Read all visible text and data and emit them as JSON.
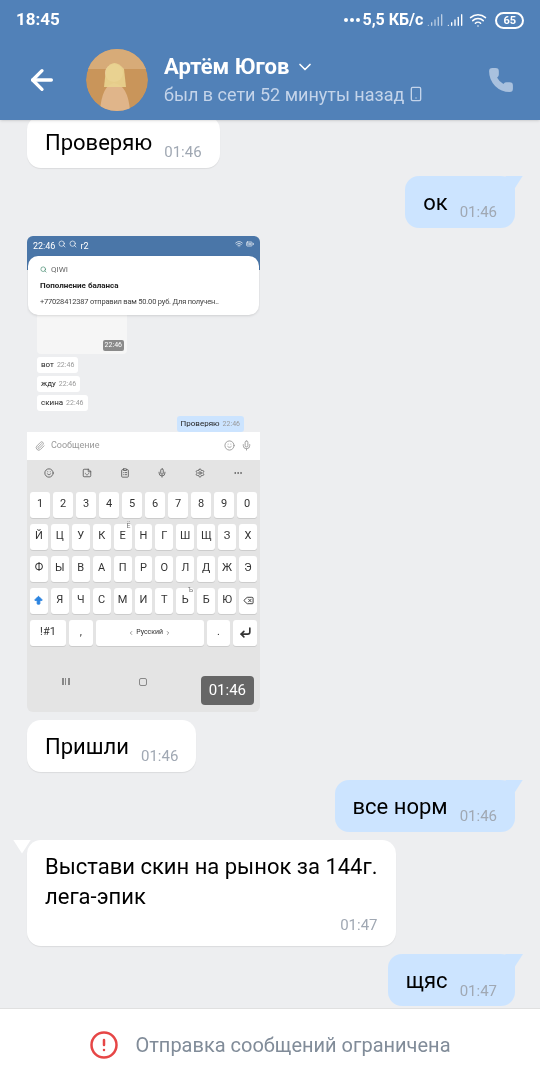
{
  "status_bar": {
    "time": "18:45",
    "network_speed": "5,5 КБ/с",
    "battery": "65"
  },
  "header": {
    "name": "Артём Югов",
    "status": "был в сети 52 минуты назад"
  },
  "messages": [
    {
      "kind": "text",
      "outgoing": false,
      "tail": false,
      "text": "Проверяю",
      "time": "01:46"
    },
    {
      "kind": "text",
      "outgoing": true,
      "tail": true,
      "text": "ок",
      "time": "01:46"
    },
    {
      "kind": "image",
      "outgoing": false,
      "time": "01:46",
      "screenshot": {
        "status_time": "22:46",
        "status_label": "r2",
        "notification": {
          "app": "QIWI",
          "title": "Пополнение баланса",
          "body": "+77028412387 отправил вам 50.00 руб. Для получен.."
        },
        "link_time": "22:46",
        "messages": [
          {
            "outgoing": false,
            "text": "вот",
            "time": "22:46"
          },
          {
            "outgoing": false,
            "text": "жду",
            "time": "22:46"
          },
          {
            "outgoing": false,
            "text": "скина",
            "time": "22:46"
          },
          {
            "outgoing": true,
            "text": "Проверяю",
            "time": "22:46"
          }
        ],
        "input_placeholder": "Сообщение",
        "keyboard": {
          "rows": [
            {
              "keys": [
                {
                  "kind": "char",
                  "label": "1"
                },
                {
                  "kind": "char",
                  "label": "2"
                },
                {
                  "kind": "char",
                  "label": "3"
                },
                {
                  "kind": "char",
                  "label": "4"
                },
                {
                  "kind": "char",
                  "label": "5"
                },
                {
                  "kind": "char",
                  "label": "6"
                },
                {
                  "kind": "char",
                  "label": "7"
                },
                {
                  "kind": "char",
                  "label": "8"
                },
                {
                  "kind": "char",
                  "label": "9"
                },
                {
                  "kind": "char",
                  "label": "0"
                }
              ]
            },
            {
              "keys": [
                {
                  "kind": "char",
                  "label": "Й"
                },
                {
                  "kind": "char",
                  "label": "Ц"
                },
                {
                  "kind": "char",
                  "label": "У"
                },
                {
                  "kind": "char",
                  "label": "К"
                },
                {
                  "kind": "char",
                  "label": "Е",
                  "hint": "Ё"
                },
                {
                  "kind": "char",
                  "label": "Н"
                },
                {
                  "kind": "char",
                  "label": "Г"
                },
                {
                  "kind": "char",
                  "label": "Ш"
                },
                {
                  "kind": "char",
                  "label": "Щ"
                },
                {
                  "kind": "char",
                  "label": "З"
                },
                {
                  "kind": "char",
                  "label": "Х"
                }
              ]
            },
            {
              "keys": [
                {
                  "kind": "char",
                  "label": "Ф"
                },
                {
                  "kind": "char",
                  "label": "Ы"
                },
                {
                  "kind": "char",
                  "label": "В"
                },
                {
                  "kind": "char",
                  "label": "А"
                },
                {
                  "kind": "char",
                  "label": "П"
                },
                {
                  "kind": "char",
                  "label": "Р"
                },
                {
                  "kind": "char",
                  "label": "О"
                },
                {
                  "kind": "char",
                  "label": "Л"
                },
                {
                  "kind": "char",
                  "label": "Д"
                },
                {
                  "kind": "char",
                  "label": "Ж"
                },
                {
                  "kind": "char",
                  "label": "Э"
                }
              ]
            },
            {
              "keys": [
                {
                  "kind": "shift"
                },
                {
                  "kind": "char",
                  "label": "Я"
                },
                {
                  "kind": "char",
                  "label": "Ч"
                },
                {
                  "kind": "char",
                  "label": "С"
                },
                {
                  "kind": "char",
                  "label": "М"
                },
                {
                  "kind": "char",
                  "label": "И"
                },
                {
                  "kind": "char",
                  "label": "Т"
                },
                {
                  "kind": "char",
                  "label": "Ь",
                  "hint": "Ъ"
                },
                {
                  "kind": "char",
                  "label": "Б"
                },
                {
                  "kind": "char",
                  "label": "Ю"
                },
                {
                  "kind": "backspace"
                }
              ]
            },
            {
              "keys": [
                {
                  "kind": "mode",
                  "label": "!#1"
                },
                {
                  "kind": "char",
                  "label": ","
                },
                {
                  "kind": "space",
                  "label": "Русский"
                },
                {
                  "kind": "char",
                  "label": "."
                },
                {
                  "kind": "enter"
                }
              ]
            }
          ]
        }
      }
    },
    {
      "kind": "text",
      "outgoing": false,
      "tail": false,
      "text": "Пришли",
      "time": "01:46"
    },
    {
      "kind": "text",
      "outgoing": true,
      "tail": true,
      "text": "все норм",
      "time": "01:46"
    },
    {
      "kind": "text",
      "outgoing": false,
      "tail": true,
      "text": "Выстави скин на рынок за 144г.\nлега-эпик",
      "time": "01:47"
    },
    {
      "kind": "text",
      "outgoing": true,
      "tail": true,
      "text": "щяс",
      "time": "01:47"
    }
  ],
  "footer": {
    "notice": "Отправка сообщений ограничена"
  }
}
